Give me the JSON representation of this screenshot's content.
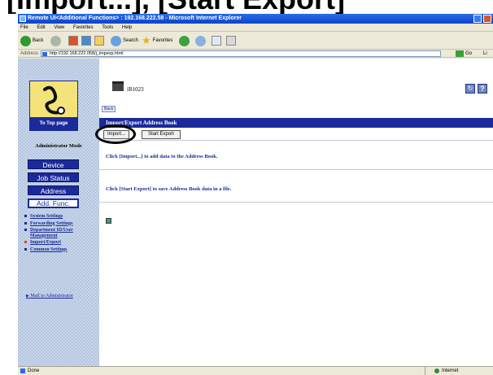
{
  "page_heading": "[Import...], [Start Export]",
  "window": {
    "title": "Remote UI<Additional Functions> : 192.168.222.58 - Microsoft Internet Explorer"
  },
  "menubar": {
    "items": [
      "File",
      "Edit",
      "View",
      "Favorites",
      "Tools",
      "Help"
    ]
  },
  "toolbar": {
    "back_label": "Back",
    "search_label": "Search",
    "favorites_label": "Favorites"
  },
  "addressbar": {
    "label": "Address",
    "url": "http://192.168.222.058/j_impexp.html",
    "go_label": "Go",
    "links_label": "Li"
  },
  "sidebar": {
    "logo_label": "To Top page",
    "admin_mode": "Administrator Mode",
    "nav": [
      "Device",
      "Job Status",
      "Address",
      "Add. Func."
    ],
    "active_nav": "Add. Func.",
    "links": [
      "System Settings",
      "Forwarding Settings",
      "Department ID/User Management",
      "Import/Export",
      "Common Settings"
    ],
    "current_link": "Import/Export",
    "mail_link": "Mail to Administrator"
  },
  "main": {
    "device_name": "iR1023",
    "back_label": "Back",
    "section_title": "Import/Export Address Book",
    "import_button": "Import...",
    "export_button": "Start Export",
    "import_desc": "Click [Import...] to add data to the Address Book.",
    "export_desc": "Click [Start Export] to save Address Book data in a file."
  },
  "statusbar": {
    "status": "Done",
    "zone": "Internet"
  },
  "colors": {
    "nav_blue": "#1b2a9a",
    "section_bar": "#1b2a9a",
    "title_bar": "#0a44c8",
    "sidebar_pattern": "#c9d6ea"
  }
}
